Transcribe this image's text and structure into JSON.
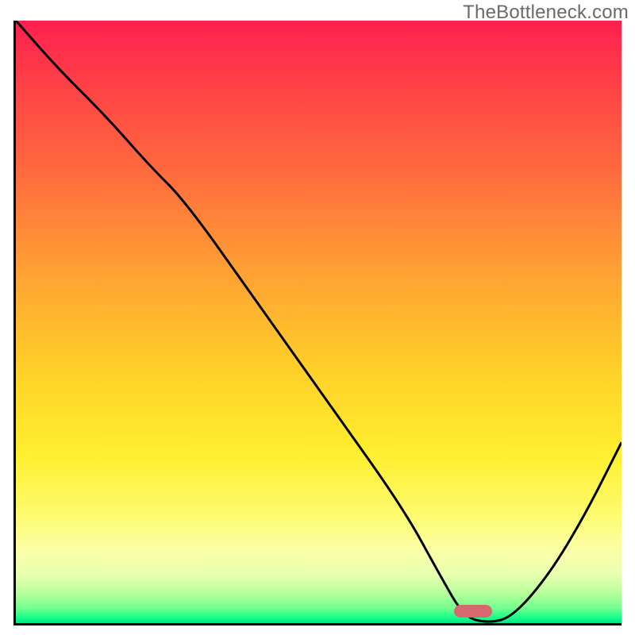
{
  "watermark": "TheBottleneck.com",
  "colors": {
    "curve": "#000000",
    "marker": "#d6696f",
    "axis": "#000000"
  },
  "chart_data": {
    "type": "line",
    "title": "",
    "xlabel": "",
    "ylabel": "",
    "xlim": [
      0,
      100
    ],
    "ylim": [
      0,
      100
    ],
    "notes": "Background is a vertical heat gradient (red at top = high bottleneck, green at bottom = low). The black curve shows bottleneck % vs an implicit x parameter. The pink pill marks the curve minimum near x≈75, y≈0.",
    "series": [
      {
        "name": "bottleneck-curve",
        "x": [
          0,
          7,
          15,
          22,
          28,
          40,
          52,
          64,
          70,
          74,
          78,
          82,
          88,
          94,
          100
        ],
        "y": [
          100,
          92,
          84,
          76,
          70,
          53,
          36,
          19,
          8,
          1,
          0,
          1,
          8,
          18,
          30
        ]
      }
    ],
    "minimum_marker": {
      "x": 75.5,
      "y": 2.0
    }
  }
}
